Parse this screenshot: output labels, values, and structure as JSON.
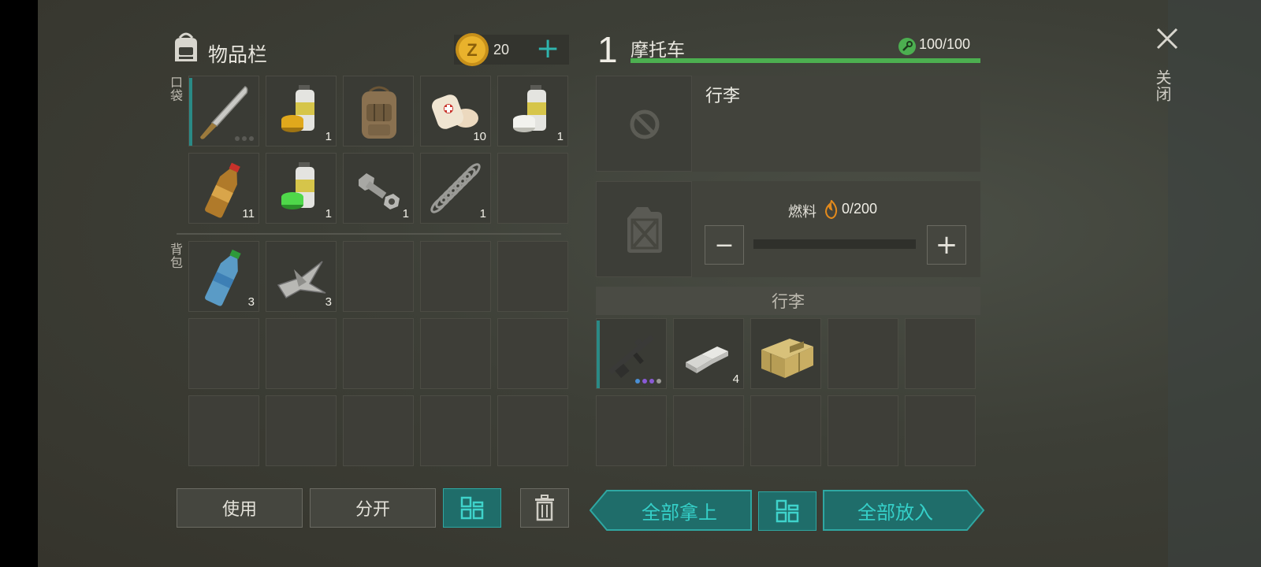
{
  "inventory": {
    "title": "物品栏",
    "coins": "20",
    "pocket_label": "口袋",
    "backpack_label": "背包",
    "pocket_items": [
      {
        "name": "machete",
        "count": "",
        "marker": true,
        "dots": true
      },
      {
        "name": "yellow-paint-can",
        "count": "1"
      },
      {
        "name": "backpack",
        "count": ""
      },
      {
        "name": "bandage",
        "count": "10"
      },
      {
        "name": "white-paint-can",
        "count": "1"
      },
      {
        "name": "bottle-drink",
        "count": "11"
      },
      {
        "name": "green-paint-can",
        "count": "1"
      },
      {
        "name": "bolt-and-nut",
        "count": "1"
      },
      {
        "name": "spring",
        "count": "1"
      },
      {
        "name": "empty",
        "count": ""
      }
    ],
    "backpack_items": [
      {
        "name": "water-bottle",
        "count": "3"
      },
      {
        "name": "scrap-metal",
        "count": "3"
      }
    ]
  },
  "buttons": {
    "use": "使用",
    "split": "分开",
    "take_all": "全部拿上",
    "put_all": "全部放入"
  },
  "vehicle": {
    "level": "1",
    "name": "摩托车",
    "durability": "100/100",
    "durability_fraction": 1.0,
    "luggage_title": "行李",
    "fuel_label": "燃料",
    "fuel_value": "0/200",
    "fuel_fraction": 0.0,
    "luggage_header": "行李",
    "luggage_items": [
      {
        "name": "assault-rifle",
        "count": ""
      },
      {
        "name": "metal-ingots",
        "count": "4"
      },
      {
        "name": "weapon-crate",
        "count": ""
      }
    ]
  },
  "close_label": "关闭",
  "colors": {
    "accent_teal": "#2fa7a2",
    "health_green": "#4caf50",
    "coin_gold": "#e0a81c"
  }
}
